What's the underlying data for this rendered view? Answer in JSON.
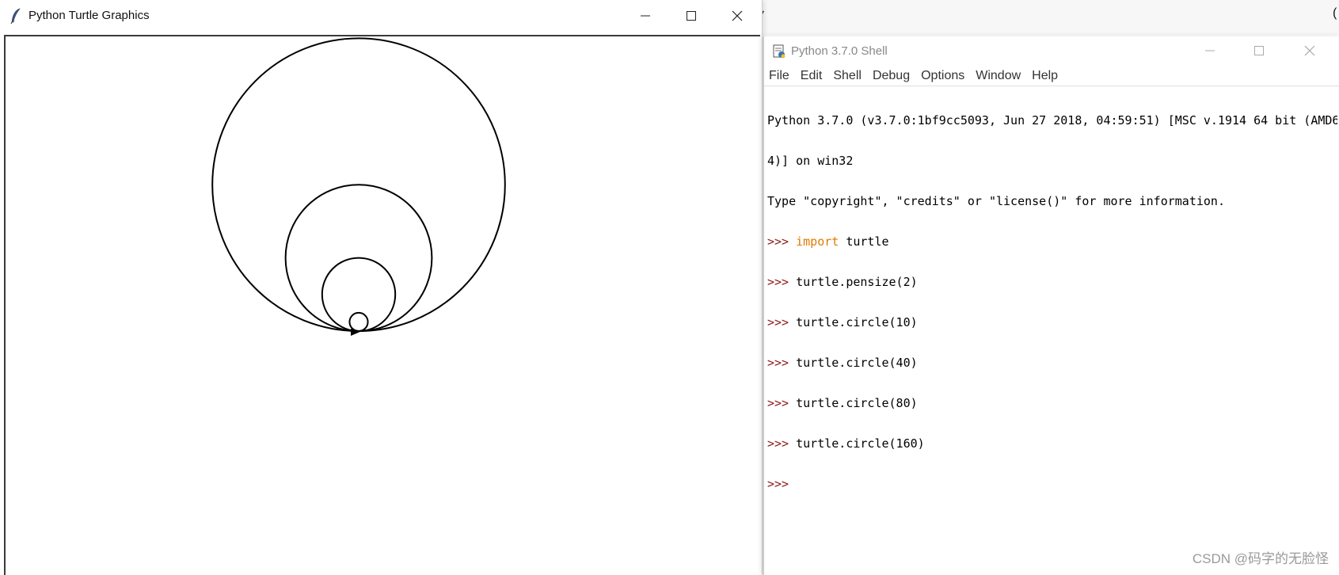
{
  "background": {
    "dropdown_label": "▾",
    "right_edge_glyph": "("
  },
  "turtle_window": {
    "title": "Python Turtle Graphics",
    "icon": "feather-icon",
    "controls": [
      "minimize-icon",
      "maximize-icon",
      "close-icon"
    ],
    "pen_color": "#000000",
    "drawing": {
      "commands": [
        "turtle.pensize(2)",
        "turtle.circle(10)",
        "turtle.circle(40)",
        "turtle.circle(80)",
        "turtle.circle(160)"
      ]
    }
  },
  "shell_window": {
    "title": "Python 3.7.0 Shell",
    "icon": "python-shell-icon",
    "controls": [
      "minimize-icon",
      "maximize-icon",
      "close-icon"
    ],
    "menu": [
      "File",
      "Edit",
      "Shell",
      "Debug",
      "Options",
      "Window",
      "Help"
    ],
    "banner": [
      "Python 3.7.0 (v3.7.0:1bf9cc5093, Jun 27 2018, 04:59:51) [MSC v.1914 64 bit (AMD6",
      "4)] on win32",
      "Type \"copyright\", \"credits\" or \"license()\" for more information."
    ],
    "prompt": ">>>",
    "lines": [
      {
        "keyword": "import",
        "rest": " turtle"
      },
      {
        "keyword": "",
        "rest": "turtle.pensize(2)"
      },
      {
        "keyword": "",
        "rest": "turtle.circle(10)"
      },
      {
        "keyword": "",
        "rest": "turtle.circle(40)"
      },
      {
        "keyword": "",
        "rest": "turtle.circle(80)"
      },
      {
        "keyword": "",
        "rest": "turtle.circle(160)"
      },
      {
        "keyword": "",
        "rest": ""
      }
    ],
    "colors": {
      "prompt": "#8b1a1a",
      "keyword": "#e07b00"
    }
  },
  "watermark": "CSDN @码字的无脸怪"
}
